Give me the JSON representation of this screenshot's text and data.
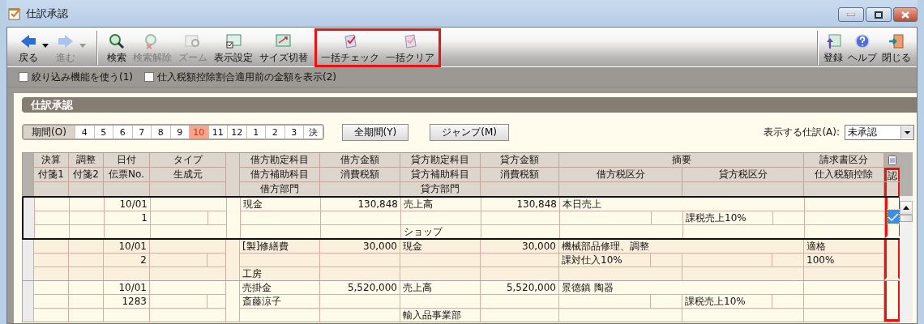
{
  "window": {
    "title": "仕訳承認"
  },
  "toolbar": {
    "groups": [
      {
        "highlighted": false,
        "items": [
          {
            "kind": "back",
            "label": "戻る",
            "disabled": false,
            "dropdown": true
          },
          {
            "kind": "forward",
            "label": "進む",
            "disabled": true,
            "dropdown": true
          }
        ]
      },
      {
        "highlighted": false,
        "items": [
          {
            "kind": "search",
            "label": "検索",
            "disabled": false,
            "dropdown": false
          },
          {
            "kind": "clear-search",
            "label": "検索解除",
            "disabled": true,
            "dropdown": false
          },
          {
            "kind": "zoom",
            "label": "ズーム",
            "disabled": true,
            "dropdown": false
          },
          {
            "kind": "display",
            "label": "表示設定",
            "disabled": false,
            "dropdown": false
          },
          {
            "kind": "size",
            "label": "サイズ切替",
            "disabled": false,
            "dropdown": false
          }
        ]
      },
      {
        "highlighted": true,
        "items": [
          {
            "kind": "check",
            "label": "一括チェック",
            "disabled": false,
            "dropdown": false
          },
          {
            "kind": "clear",
            "label": "一括クリア",
            "disabled": false,
            "dropdown": false
          }
        ]
      }
    ],
    "right": [
      {
        "kind": "register",
        "label": "登録",
        "disabled": false,
        "dropdown": false
      },
      {
        "kind": "help",
        "label": "ヘルプ",
        "disabled": false,
        "dropdown": false
      },
      {
        "kind": "close",
        "label": "閉じる",
        "disabled": false,
        "dropdown": false
      }
    ]
  },
  "options": [
    {
      "label": "絞り込み機能を使う(1)",
      "checked": false
    },
    {
      "label": "仕入税額控除割合適用前の金額を表示(2)",
      "checked": false
    }
  ],
  "panel": {
    "title": "仕訳承認",
    "period_label": "期間(O)",
    "periods": [
      {
        "label": "4",
        "selected": false
      },
      {
        "label": "5",
        "selected": false
      },
      {
        "label": "6",
        "selected": false
      },
      {
        "label": "7",
        "selected": false
      },
      {
        "label": "8",
        "selected": false
      },
      {
        "label": "9",
        "selected": false
      },
      {
        "label": "10",
        "selected": true
      },
      {
        "label": "11",
        "selected": false
      },
      {
        "label": "12",
        "selected": false
      },
      {
        "label": "1",
        "selected": false
      },
      {
        "label": "2",
        "selected": false
      },
      {
        "label": "3",
        "selected": false
      },
      {
        "label": "決",
        "selected": false
      }
    ],
    "buttons": [
      "全期間(Y)",
      "ジャンプ(M)"
    ],
    "filter": {
      "label": "表示する仕訳(A):",
      "value": "未承認"
    }
  },
  "table": {
    "header": {
      "row_1": [
        "決算",
        "調整",
        "日付",
        "タイプ",
        "借方勘定科目",
        "借方金額",
        "貸方勘定科目",
        "貸方金額",
        "摘要",
        "請求書区分"
      ],
      "row_2": [
        "付箋1",
        "付箋2",
        "伝票No.",
        "生成元",
        "借方補助科目",
        "消費税額",
        "貸方補助科目",
        "消費税額",
        "借方税区分",
        "貸方税区分",
        "仕入税額控除",
        "認"
      ],
      "row_3": [
        "借方部門",
        "貸方部門"
      ]
    },
    "approval_column_highlighted": true,
    "entries": [
      {
        "selected": true,
        "approved": true,
        "date": "10/01",
        "slip_no": "1",
        "debit_account": "現金",
        "debit_amount": "130,848",
        "credit_account": "売上高",
        "credit_amount": "130,848",
        "summary": "本日売上",
        "credit_tax": "課税売上10%",
        "credit_dept": "ショップ"
      },
      {
        "selected": false,
        "approved": false,
        "date": "10/01",
        "slip_no": "2",
        "debit_account": "[製]修繕費",
        "debit_amount": "30,000",
        "credit_account": "現金",
        "credit_amount": "30,000",
        "summary": "機械部品修理、調整",
        "debit_tax": "課対仕入10%",
        "invoice": "適格",
        "deduction": "100%",
        "debit_dept": "工房"
      },
      {
        "selected": false,
        "approved": false,
        "date": "10/01",
        "slip_no": "1283",
        "debit_account": "売掛金",
        "debit_amount": "5,520,000",
        "credit_account": "売上高",
        "credit_amount": "5,520,000",
        "summary": "景徳鎮 陶器",
        "debit_sub": "斎藤涼子",
        "credit_tax": "課税売上10%",
        "credit_dept": "輸入品事業部"
      }
    ]
  }
}
